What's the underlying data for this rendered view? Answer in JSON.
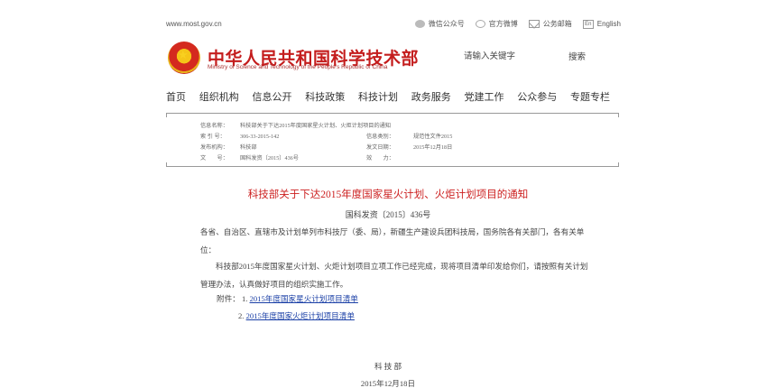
{
  "topbar": {
    "site": "www.most.gov.cn",
    "links": [
      {
        "label": "微信公众号",
        "icon": "wechat-icon"
      },
      {
        "label": "官方微博",
        "icon": "weibo-icon"
      },
      {
        "label": "公务邮箱",
        "icon": "mail-icon"
      },
      {
        "label": "English",
        "icon": "english-icon"
      }
    ]
  },
  "header": {
    "title_cn": "中华人民共和国科学技术部",
    "title_en": "Ministry of Science and Technology of the People's Republic of China",
    "search_placeholder": "请输入关键字",
    "search_button": "搜索"
  },
  "nav": [
    "首页",
    "组织机构",
    "信息公开",
    "科技政策",
    "科技计划",
    "政务服务",
    "党建工作",
    "公众参与",
    "专题专栏"
  ],
  "info": {
    "name_label": "信息名称：",
    "name_value": "科技部关于下达2015年度国家星火计划、火炬计划项目的通知",
    "index_label": "索 引 号：",
    "index_value": "306-33-2015-142",
    "category_label": "信息类别：",
    "category_value": "规范性文件2015",
    "issuer_label": "发布机构：",
    "issuer_value": "科技部",
    "date_label": "发文日期：",
    "date_value": "2015年12月18日",
    "number_label": "文　　号：",
    "number_value": "国科发资〔2015〕436号",
    "validity_label": "效　　力："
  },
  "doc": {
    "title": "科技部关于下达2015年度国家星火计划、火炬计划项目的通知",
    "number": "国科发资〔2015〕436号",
    "para1": "各省、自治区、直辖市及计划单列市科技厅（委、局），新疆生产建设兵团科技局，国务院各有关部门，各有关单位：",
    "para2": "科技部2015年度国家星火计划、火炬计划项目立项工作已经完成，现将项目清单印发给你们，请按照有关计划管理办法，认真做好项目的组织实施工作。",
    "attach_label": "附件：",
    "attach1_num": "1.",
    "attach1": "2015年度国家星火计划项目清单",
    "attach2_num": "2.",
    "attach2": "2015年度国家火炬计划项目清单",
    "signer": "科 技 部",
    "sign_date": "2015年12月18日"
  }
}
